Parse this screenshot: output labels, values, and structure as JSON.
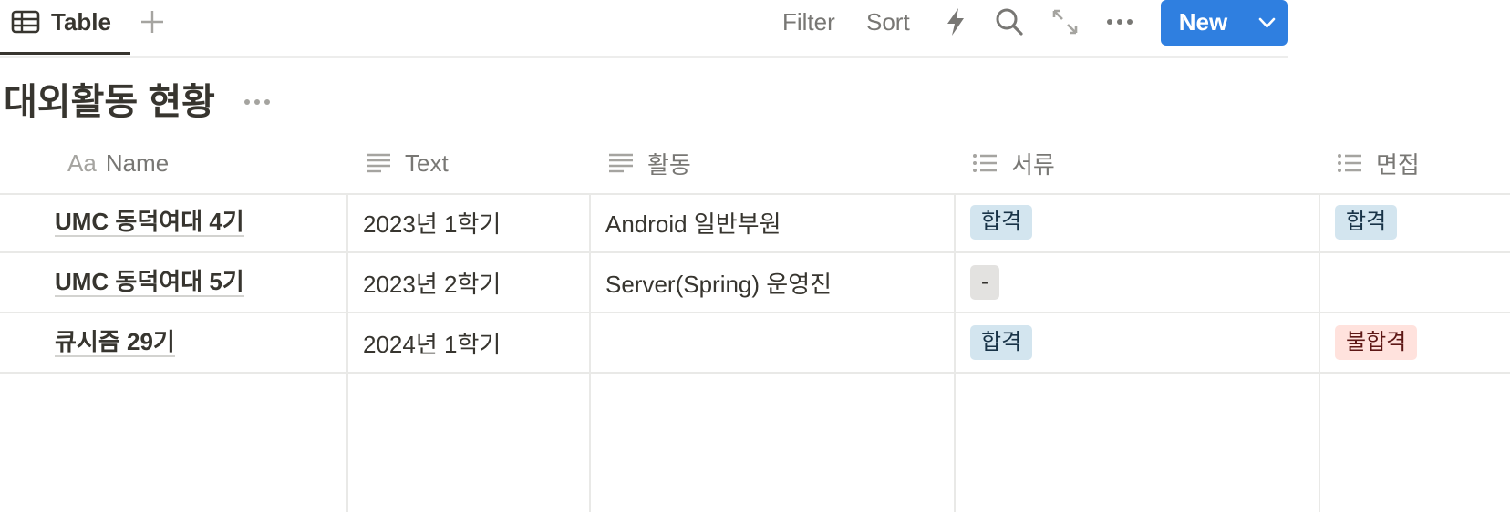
{
  "viewbar": {
    "tab_label": "Table",
    "tab_icon": "table-icon",
    "filter_label": "Filter",
    "sort_label": "Sort",
    "new_label": "New",
    "accent_color": "#2f7fe0"
  },
  "page": {
    "title": "대외활동 현황"
  },
  "table": {
    "columns": [
      {
        "label": "Name",
        "icon": "aa-text-icon",
        "prefix": "Aa"
      },
      {
        "label": "Text",
        "icon": "lines-icon"
      },
      {
        "label": "활동",
        "icon": "lines-icon"
      },
      {
        "label": "서류",
        "icon": "list-icon"
      },
      {
        "label": "면접",
        "icon": "list-icon"
      }
    ],
    "rows": [
      {
        "name": "UMC 동덕여대 4기",
        "text": "2023년 1학기",
        "activity": "Android 일반부원",
        "document": {
          "label": "합격",
          "color": "#d3e5ef"
        },
        "interview": {
          "label": "합격",
          "color": "#d3e5ef"
        }
      },
      {
        "name": "UMC 동덕여대 5기",
        "text": "2023년 2학기",
        "activity": "Server(Spring) 운영진",
        "document": {
          "label": "-",
          "color": "#e3e2e0"
        },
        "interview": {
          "label": "",
          "color": ""
        }
      },
      {
        "name": "큐시즘 29기",
        "text": "2024년 1학기",
        "activity": "",
        "document": {
          "label": "합격",
          "color": "#d3e5ef"
        },
        "interview": {
          "label": "불합격",
          "color": "#ffe2dd"
        }
      }
    ]
  }
}
